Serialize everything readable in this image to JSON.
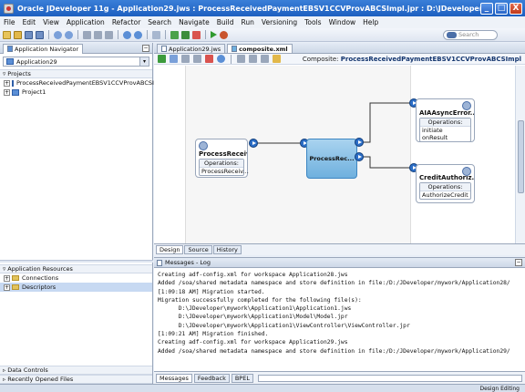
{
  "window": {
    "title": "Oracle JDeveloper 11g - Application29.jws : ProcessReceivedPaymentEBSV1CCVProvABCSImpl.jpr : D:\\JDeveloper\\mywork\\Application29\\ProcessR...",
    "min": "_",
    "max": "□",
    "close": "X"
  },
  "menu": [
    "File",
    "Edit",
    "View",
    "Application",
    "Refactor",
    "Search",
    "Navigate",
    "Build",
    "Run",
    "Versioning",
    "Tools",
    "Window",
    "Help"
  ],
  "toolbar": {
    "search_placeholder": "Search"
  },
  "navigator": {
    "tab_label": "Application Navigator",
    "app_selector": "Application29",
    "projects_header": "Projects",
    "projects": [
      "ProcessReceivedPaymentEBSV1CCVProvABCSImpl",
      "Project1"
    ]
  },
  "resources": {
    "header": "Application Resources",
    "items": [
      "Connections",
      "Descriptors"
    ]
  },
  "left_bottom": [
    "Data Controls",
    "Recently Opened Files"
  ],
  "editor": {
    "tabs": [
      "Application29.jws",
      "composite.xml"
    ],
    "composite_label": "Composite:",
    "composite_name": "ProcessReceivedPaymentEBSV1CCVProvABCSImpl",
    "bottom_tabs": [
      "Design",
      "Source",
      "History"
    ]
  },
  "diagram": {
    "service_left": {
      "name": "ProcessReceiv...",
      "ops_header": "Operations:",
      "op": "ProcessReceiv..."
    },
    "bpel": {
      "name": "ProcessRec..."
    },
    "ref_top": {
      "name": "AIAAsyncError...",
      "ops_header": "Operations:",
      "ops": [
        "initiate",
        "onResult"
      ]
    },
    "ref_bottom": {
      "name": "CreditAuthoriz...",
      "ops_header": "Operations:",
      "op": "AuthorizeCredit"
    }
  },
  "messages": {
    "header": "Messages - Log",
    "lines": [
      "Creating adf-config.xml for workspace Application28.jws",
      "Added /soa/shared metadata namespace and store definition in file:/D:/JDeveloper/mywork/Application28/",
      "[1:09:18 AM] Migration started.",
      "Migration successfully completed for the following file(s):",
      "      D:\\JDeveloper\\mywork\\Application1\\Application1.jws",
      "      D:\\JDeveloper\\mywork\\Application1\\Model\\Model.jpr",
      "      D:\\JDeveloper\\mywork\\Application1\\ViewController\\ViewController.jpr",
      "[1:09:21 AM] Migration finished.",
      "Creating adf-config.xml for workspace Application29.jws",
      "Added /soa/shared metadata namespace and store definition in file:/D:/JDeveloper/mywork/Application29/"
    ],
    "tabs": [
      "Messages",
      "Feedback",
      "BPEL"
    ]
  },
  "status": {
    "text": "Design Editing"
  }
}
